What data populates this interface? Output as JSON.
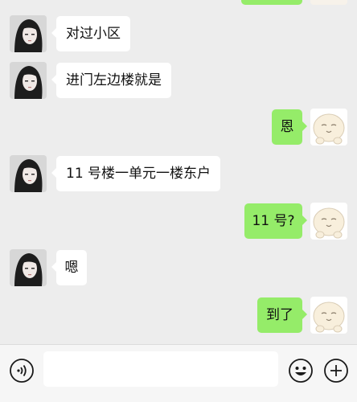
{
  "messages": [
    {
      "side": "in",
      "text": "对过小区"
    },
    {
      "side": "in",
      "text": "进门左边楼就是"
    },
    {
      "side": "out",
      "text": "恩"
    },
    {
      "side": "in",
      "text": "11 号楼一单元一楼东户"
    },
    {
      "side": "out",
      "text": "11 号?"
    },
    {
      "side": "in",
      "text": "嗯"
    },
    {
      "side": "out",
      "text": "到了"
    }
  ],
  "input": {
    "value": "",
    "placeholder": ""
  },
  "icons": {
    "voice": "voice-icon",
    "emoji": "emoji-icon",
    "more": "plus-icon"
  },
  "colors": {
    "background": "#ededed",
    "incoming_bubble": "#ffffff",
    "outgoing_bubble": "#95ec69",
    "input_bar": "#f6f6f6"
  }
}
